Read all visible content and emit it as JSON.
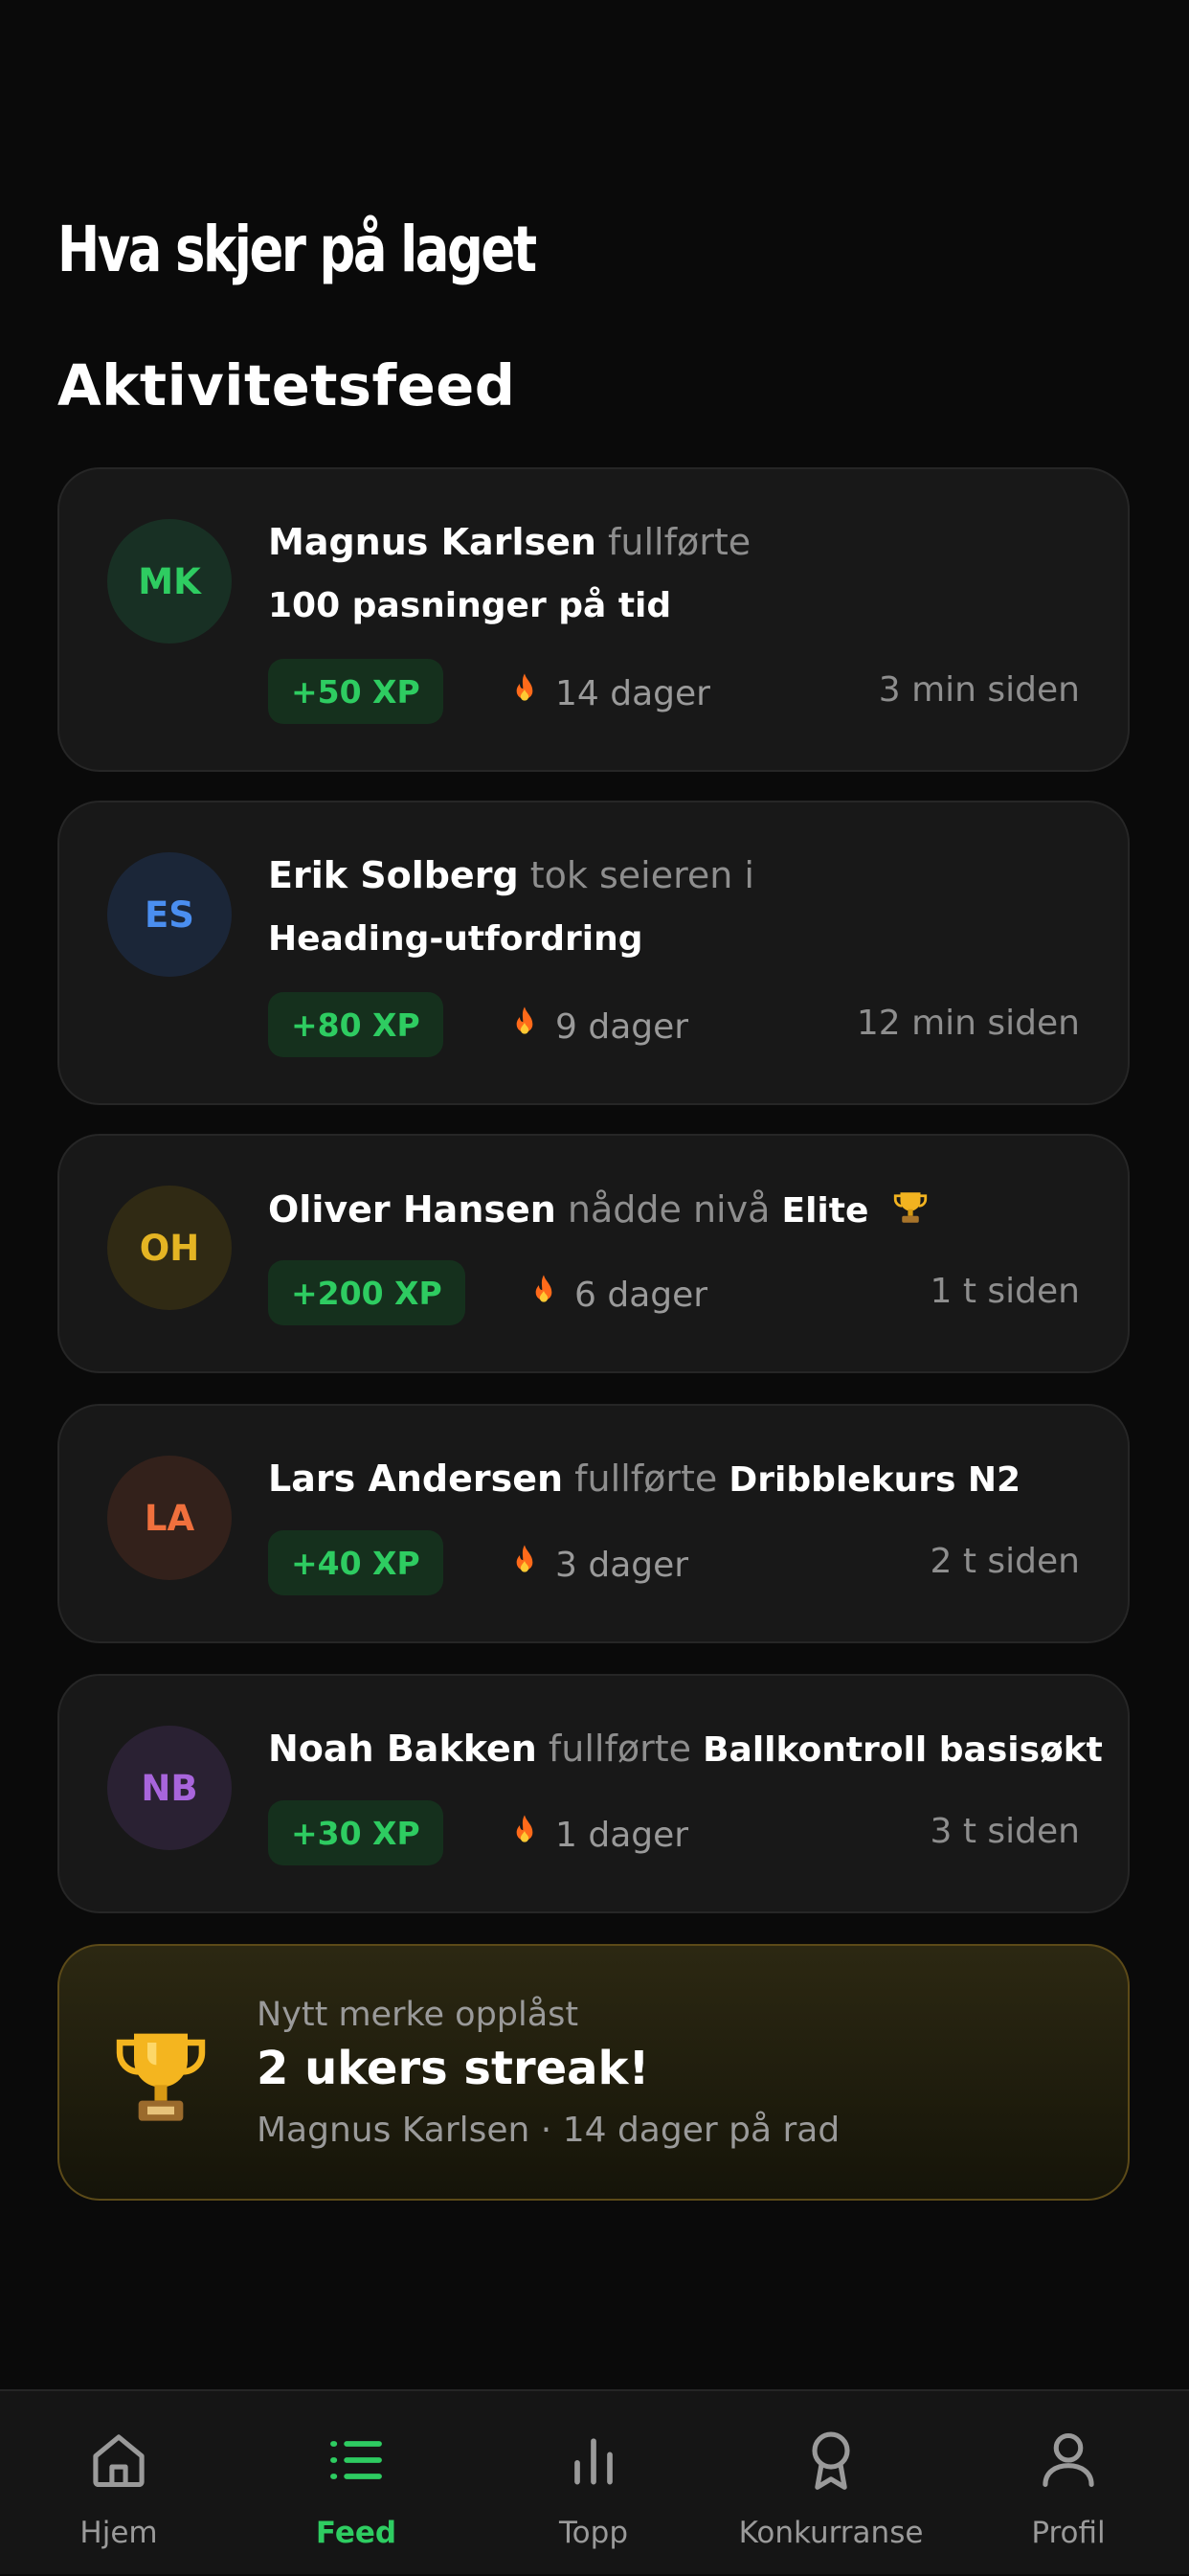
{
  "header": {
    "title": "Hva skjer på laget",
    "section_title": "Aktivitetsfeed"
  },
  "feed": [
    {
      "initials": "MK",
      "avatar_bg": "#183024",
      "avatar_fg": "#2ecc61",
      "name": "Magnus Karlsen",
      "verb": "fullførte",
      "object_inline": "",
      "object_line": "100 pasninger på tid",
      "xp": "+50 XP",
      "streak": "14 dager",
      "time": "3 min siden"
    },
    {
      "initials": "ES",
      "avatar_bg": "#1b2638",
      "avatar_fg": "#4a8ef0",
      "name": "Erik Solberg",
      "verb": "tok seieren i",
      "object_inline": "",
      "object_line": "Heading-utfordring",
      "xp": "+80 XP",
      "streak": "9 dager",
      "time": "12 min siden"
    },
    {
      "initials": "OH",
      "avatar_bg": "#302a14",
      "avatar_fg": "#e4b423",
      "name": "Oliver Hansen",
      "verb": "nådde nivå",
      "object_inline": "Elite",
      "object_line": "",
      "xp": "+200 XP",
      "streak": "6 dager",
      "time": "1 t siden"
    },
    {
      "initials": "LA",
      "avatar_bg": "#33211b",
      "avatar_fg": "#f0703d",
      "name": "Lars Andersen",
      "verb": "fullførte",
      "object_inline": "Dribblekurs N2",
      "object_line": "",
      "xp": "+40 XP",
      "streak": "3 dager",
      "time": "2 t siden"
    },
    {
      "initials": "NB",
      "avatar_bg": "#2a2133",
      "avatar_fg": "#a865dc",
      "name": "Noah Bakken",
      "verb": "fullførte",
      "object_inline": "Ballkontroll basisøkt",
      "object_line": "",
      "xp": "+30 XP",
      "streak": "1 dager",
      "time": "3 t siden"
    }
  ],
  "badge": {
    "kicker": "Nytt merke opplåst",
    "title": "2 ukers streak!",
    "subtitle": "Magnus Karlsen · 14 dager på rad",
    "icon": "trophy-icon"
  },
  "tabs": [
    {
      "label": "Hjem",
      "icon": "home-icon",
      "active": false
    },
    {
      "label": "Feed",
      "icon": "list-icon",
      "active": true
    },
    {
      "label": "Topp",
      "icon": "bar-chart-icon",
      "active": false
    },
    {
      "label": "Konkurranse",
      "icon": "award-icon",
      "active": false
    },
    {
      "label": "Profil",
      "icon": "user-icon",
      "active": false
    }
  ],
  "colors": {
    "accent": "#2ecc61",
    "background": "#0a0a0a",
    "card": "#181818",
    "muted": "#8e8e8e"
  }
}
